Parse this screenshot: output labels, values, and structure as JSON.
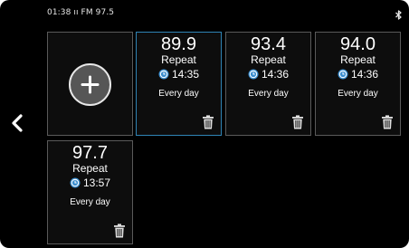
{
  "status_bar": {
    "text": "01:38 ıı FM 97.5",
    "right_icon": "bluetooth-icon"
  },
  "navigation": {
    "back_icon": "chevron-left-icon"
  },
  "add_tile": {
    "icon": "plus-circle-icon"
  },
  "alarms": [
    {
      "frequency": "89.9",
      "mode": "Repeat",
      "time": "14:35",
      "days": "Every day",
      "selected": true
    },
    {
      "frequency": "93.4",
      "mode": "Repeat",
      "time": "14:36",
      "days": "Every day",
      "selected": false
    },
    {
      "frequency": "94.0",
      "mode": "Repeat",
      "time": "14:36",
      "days": "Every day",
      "selected": false
    },
    {
      "frequency": "97.7",
      "mode": "Repeat",
      "time": "13:57",
      "days": "Every day",
      "selected": false
    }
  ],
  "colors": {
    "background": "#000000",
    "tile_border": "#5a5a5a",
    "selected_border": "#2f84b5",
    "clock_icon": "#3a8ed0",
    "text": "#ffffff"
  }
}
